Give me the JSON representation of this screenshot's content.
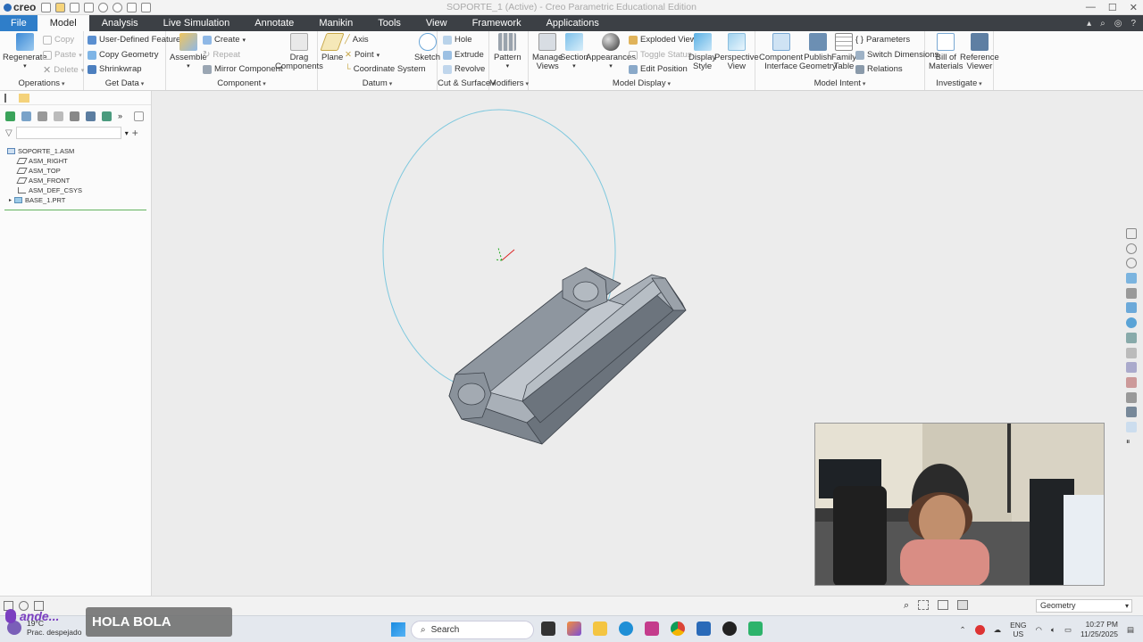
{
  "app": {
    "logo_text": "creo",
    "window_title": "SOPORTE_1 (Active) - Creo Parametric Educational Edition"
  },
  "menu": {
    "tabs": [
      {
        "label": "File"
      },
      {
        "label": "Model"
      },
      {
        "label": "Analysis"
      },
      {
        "label": "Live Simulation"
      },
      {
        "label": "Annotate"
      },
      {
        "label": "Manikin"
      },
      {
        "label": "Tools"
      },
      {
        "label": "View"
      },
      {
        "label": "Framework"
      },
      {
        "label": "Applications"
      }
    ],
    "active_tab": "Model"
  },
  "ribbon": {
    "operations": {
      "label": "Operations",
      "regenerate": "Regenerate",
      "copy": "Copy",
      "paste": "Paste",
      "delete": "Delete"
    },
    "get_data": {
      "label": "Get Data",
      "user_defined_feature": "User-Defined Feature",
      "copy_geometry": "Copy Geometry",
      "shrinkwrap": "Shrinkwrap"
    },
    "component": {
      "label": "Component",
      "assemble": "Assemble",
      "create": "Create",
      "repeat": "Repeat",
      "mirror_component": "Mirror Component",
      "drag_components_1": "Drag",
      "drag_components_2": "Components"
    },
    "datum": {
      "label": "Datum",
      "plane": "Plane",
      "axis": "Axis",
      "point": "Point",
      "coordinate_system": "Coordinate System",
      "sketch": "Sketch"
    },
    "cut_surface": {
      "label": "Cut & Surface",
      "hole": "Hole",
      "extrude": "Extrude",
      "revolve": "Revolve"
    },
    "modifiers": {
      "label": "Modifiers",
      "pattern": "Pattern"
    },
    "model_display": {
      "label": "Model Display",
      "manage_views_1": "Manage",
      "manage_views_2": "Views",
      "section": "Section",
      "appearances": "Appearances",
      "exploded_view": "Exploded View",
      "toggle_status": "Toggle Status",
      "edit_position": "Edit Position",
      "display_style_1": "Display",
      "display_style_2": "Style",
      "perspective_view_1": "Perspective",
      "perspective_view_2": "View"
    },
    "model_intent": {
      "label": "Model Intent",
      "component_interface_1": "Component",
      "component_interface_2": "Interface",
      "publish_geometry_1": "Publish",
      "publish_geometry_2": "Geometry",
      "family_table_1": "Family",
      "family_table_2": "Table",
      "parameters": "Parameters",
      "switch_dimensions": "Switch Dimensions",
      "relations": "Relations"
    },
    "investigate": {
      "label": "Investigate",
      "bill_of_materials_1": "Bill of",
      "bill_of_materials_2": "Materials",
      "reference_viewer_1": "Reference",
      "reference_viewer_2": "Viewer"
    }
  },
  "model_tree": {
    "items": [
      {
        "label": "SOPORTE_1.ASM",
        "icon": "assembly-icon"
      },
      {
        "label": "ASM_RIGHT",
        "icon": "datum-plane-icon"
      },
      {
        "label": "ASM_TOP",
        "icon": "datum-plane-icon"
      },
      {
        "label": "ASM_FRONT",
        "icon": "datum-plane-icon"
      },
      {
        "label": "ASM_DEF_CSYS",
        "icon": "csys-icon"
      },
      {
        "label": "BASE_1.PRT",
        "icon": "part-icon"
      }
    ]
  },
  "status_bar": {
    "selection_filter": "Geometry"
  },
  "overlay": {
    "caption": "HOLA BOLA",
    "brand": "ande..."
  },
  "taskbar": {
    "weather_temp": "19°C",
    "weather_desc": "Prac. despejado",
    "search_placeholder": "Search",
    "language_1": "ENG",
    "language_2": "US",
    "time": "10:27 PM",
    "date": "11/25/2025"
  },
  "colors": {
    "accent": "#2f7ec9",
    "menubar": "#3c4045",
    "model_gray": "#7f8791",
    "model_top": "#a9b0b8",
    "circle": "#7ec8de"
  }
}
